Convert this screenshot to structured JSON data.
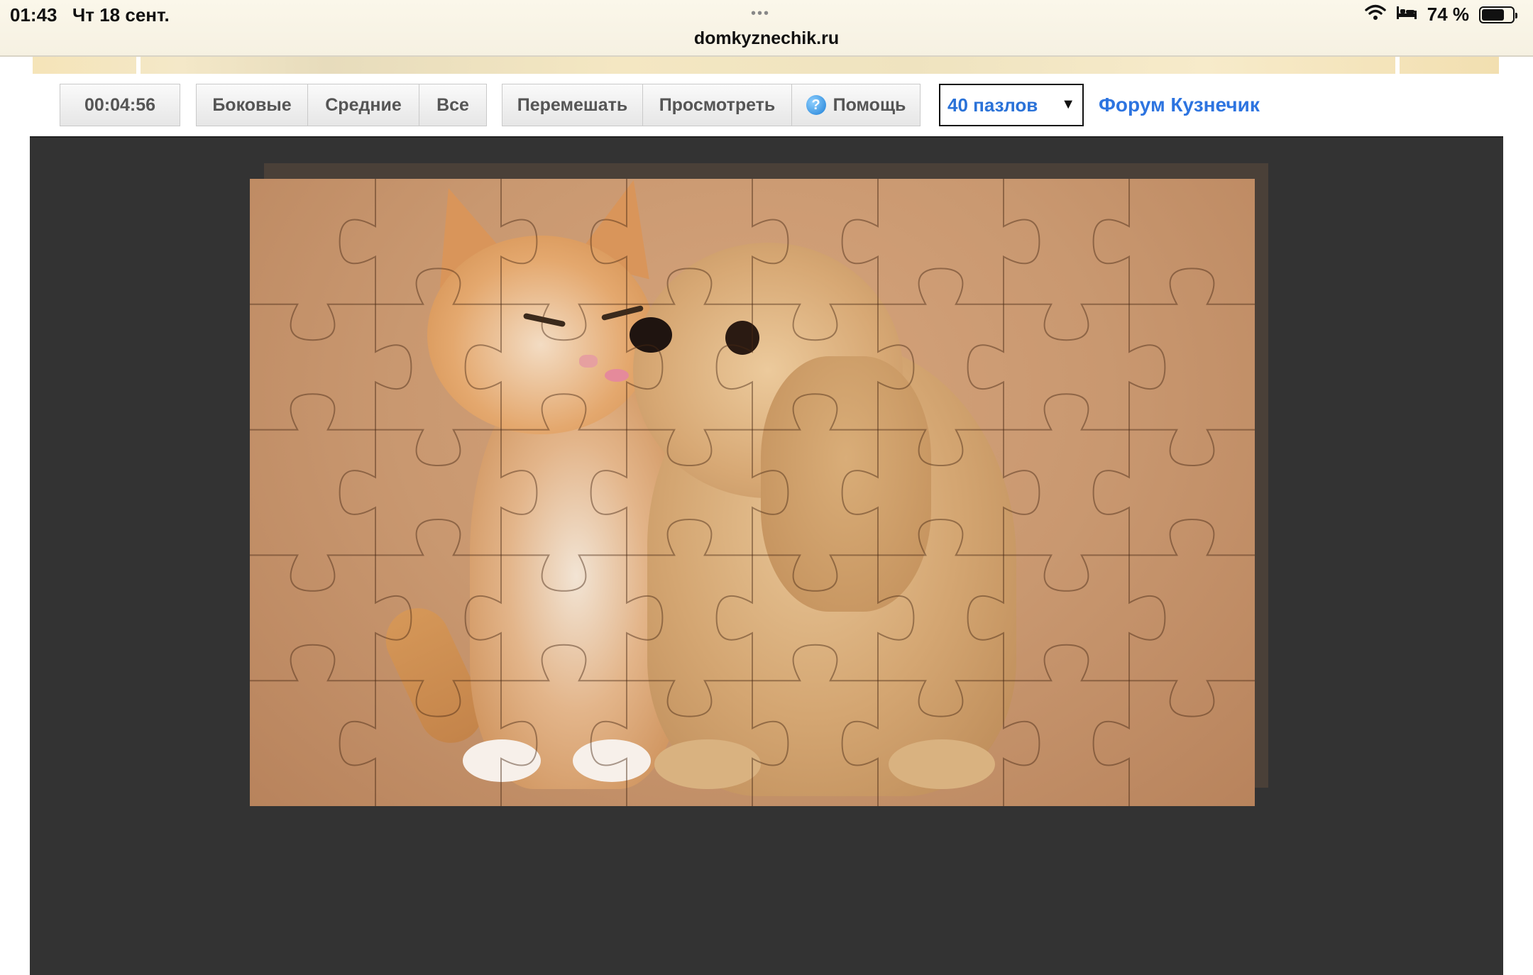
{
  "status_bar": {
    "time": "01:43",
    "date": "Чт 18 сент.",
    "dots": "•••",
    "url": "domkyznechik.ru",
    "battery_text": "74 %",
    "battery_level": 0.74
  },
  "toolbar": {
    "timer": "00:04:56",
    "filter_buttons": [
      "Боковые",
      "Средние",
      "Все"
    ],
    "action_buttons": {
      "shuffle": "Перемешать",
      "preview": "Просмотреть",
      "help": "Помощь"
    },
    "pieces_select": {
      "selected": "40 пазлов"
    },
    "forum_link": "Форум Кузнечик"
  },
  "puzzle": {
    "columns": 8,
    "rows": 5,
    "picture": "kitten-and-puppy"
  },
  "colors": {
    "board_bg": "#333333",
    "link_blue": "#2d74e0",
    "select_text": "#2a72d8"
  },
  "icons": {
    "help": "help-icon",
    "wifi": "wifi-icon",
    "bed": "bed-icon",
    "battery": "battery-icon",
    "dropdown": "chevron-down-icon"
  }
}
